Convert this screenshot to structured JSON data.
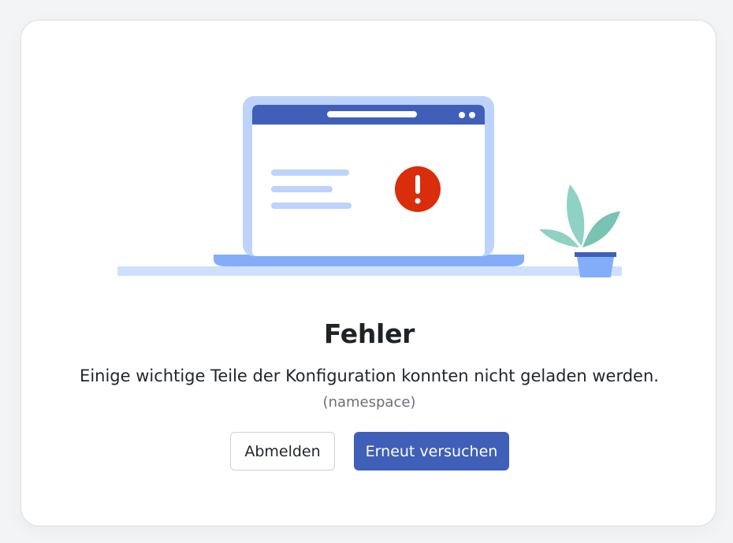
{
  "dialog": {
    "title": "Fehler",
    "message": "Einige wichtige Teile der Konfiguration konnten nicht geladen werden.",
    "error_code": "(namespace)"
  },
  "actions": {
    "logout_label": "Abmelden",
    "retry_label": "Erneut versuchen"
  },
  "illustration": {
    "alert_icon": "exclamation-icon",
    "plant_icon": "potted-plant-icon"
  },
  "colors": {
    "primary": "#3f5fb8",
    "laptop_frame": "#bdd3fb",
    "laptop_base": "#84adf9",
    "error": "#d92d0b",
    "plant_leaf": "#8fd2c4",
    "pot": "#84adf9"
  }
}
